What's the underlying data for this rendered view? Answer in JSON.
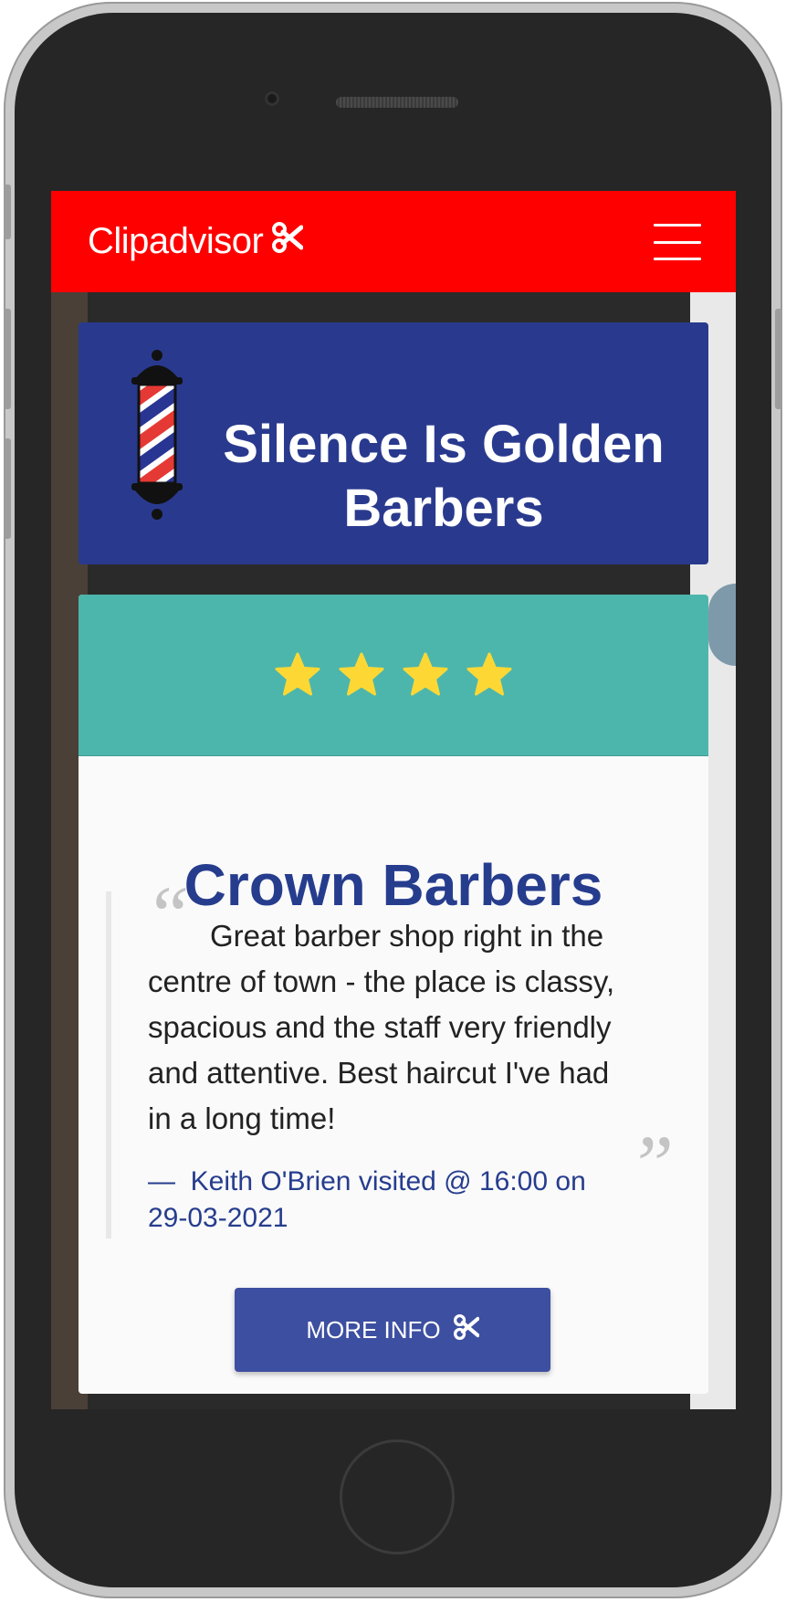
{
  "navbar": {
    "brand": "Clipadvisor",
    "brand_icon": "scissors-icon",
    "menu_icon": "hamburger-menu-icon",
    "color": "#ff0000"
  },
  "shop": {
    "title": "Silence Is Golden Barbers",
    "icon": "barber-pole-icon",
    "color": "#293a8e"
  },
  "review": {
    "rating": 4,
    "stars_color": "#fdd835",
    "band_color": "#4db6ac",
    "barber_name": "Crown Barbers",
    "text": "Great barber shop right in the centre of town - the place is classy, spacious and the staff very friendly and attentive. Best haircut I've had in a long time!",
    "author_dash": "—",
    "author": "Keith O'Brien visited @ 16:00 on 29-03-2021",
    "open_quote": "“",
    "close_quote": "”",
    "button_label": "MORE INFO",
    "button_icon": "scissors-icon"
  }
}
